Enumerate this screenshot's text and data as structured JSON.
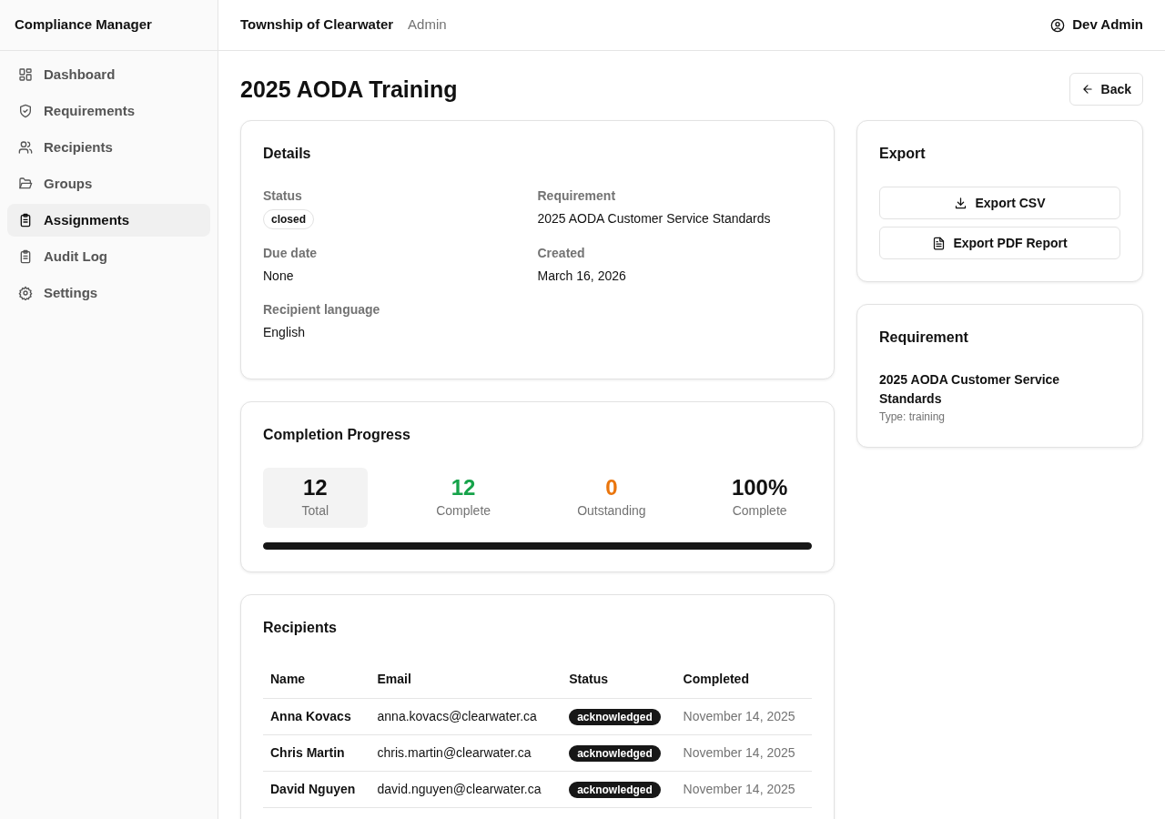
{
  "app_title": "Compliance Manager",
  "sidebar": {
    "items": [
      {
        "label": "Dashboard",
        "selected": false
      },
      {
        "label": "Requirements",
        "selected": false
      },
      {
        "label": "Recipients",
        "selected": false
      },
      {
        "label": "Groups",
        "selected": false
      },
      {
        "label": "Assignments",
        "selected": true
      },
      {
        "label": "Audit Log",
        "selected": false
      },
      {
        "label": "Settings",
        "selected": false
      }
    ]
  },
  "header": {
    "organization": "Township of Clearwater",
    "role": "Admin",
    "user": "Dev Admin"
  },
  "page_title": "2025 AODA Training",
  "back_button": "Back",
  "details": {
    "title": "Details",
    "fields": [
      {
        "label": "Status",
        "value": "closed",
        "kind": "badge"
      },
      {
        "label": "Requirement",
        "value": "2025 AODA Customer Service Standards",
        "kind": "text"
      },
      {
        "label": "Due date",
        "value": "None",
        "kind": "text"
      },
      {
        "label": "Created",
        "value": "March 16, 2026",
        "kind": "text"
      },
      {
        "label": "Recipient language",
        "value": "English",
        "kind": "text"
      }
    ]
  },
  "progress": {
    "title": "Completion Progress",
    "stats": [
      {
        "value": "12",
        "label": "Total",
        "color": "#111111",
        "selected": true
      },
      {
        "value": "12",
        "label": "Complete",
        "color": "#16a34a",
        "selected": false
      },
      {
        "value": "0",
        "label": "Outstanding",
        "color": "#ea750c",
        "selected": false
      },
      {
        "value": "100%",
        "label": "Complete",
        "color": "#111111",
        "selected": false
      }
    ],
    "level": 1.0
  },
  "recipients": {
    "title": "Recipients",
    "columns": [
      "Name",
      "Email",
      "Status",
      "Completed"
    ],
    "rows": [
      {
        "name": "Anna Kovacs",
        "email": "anna.kovacs@clearwater.ca",
        "status": "acknowledged",
        "completed": "November 14, 2025"
      },
      {
        "name": "Chris Martin",
        "email": "chris.martin@clearwater.ca",
        "status": "acknowledged",
        "completed": "November 14, 2025"
      },
      {
        "name": "David Nguyen",
        "email": "david.nguyen@clearwater.ca",
        "status": "acknowledged",
        "completed": "November 14, 2025"
      }
    ]
  },
  "export": {
    "title": "Export",
    "buttons": [
      {
        "label": "Export CSV",
        "kind": "download"
      },
      {
        "label": "Export PDF Report",
        "kind": "document"
      }
    ]
  },
  "requirement": {
    "title": "Requirement",
    "name": "2025 AODA Customer Service Standards",
    "type": "Type: training"
  }
}
